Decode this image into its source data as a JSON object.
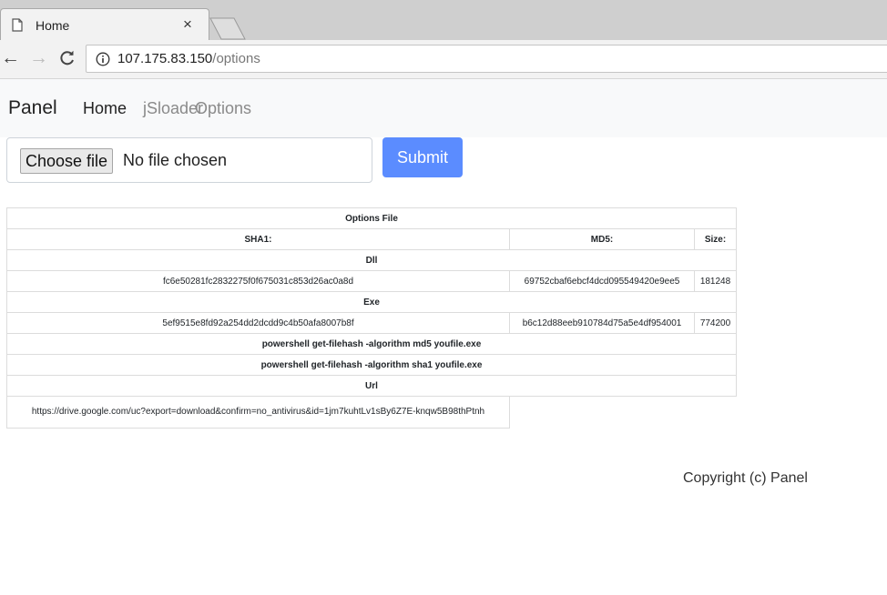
{
  "browser": {
    "tab_title": "Home",
    "tab_close": "×",
    "url_host": "107.175.83.150",
    "url_path": "/options"
  },
  "navbar": {
    "brand": "Panel",
    "links": [
      "Home",
      "jSloader",
      "Options"
    ]
  },
  "upload": {
    "choose_label": "Choose file",
    "status": "No file chosen",
    "submit_label": "Submit"
  },
  "table": {
    "title": "Options File",
    "headers": {
      "sha1": "SHA1:",
      "md5": "MD5:",
      "size": "Size:"
    },
    "dll": {
      "label": "Dll",
      "sha1": "fc6e50281fc2832275f0f675031c853d26ac0a8d",
      "md5": "69752cbaf6ebcf4dcd095549420e9ee5",
      "size": "181248"
    },
    "exe": {
      "label": "Exe",
      "sha1": "5ef9515e8fd92a254dd2dcdd9c4b50afa8007b8f",
      "md5": "b6c12d88eeb910784d75a5e4df954001",
      "size": "774200"
    },
    "cmd_md5": "powershell get-filehash -algorithm md5 youfile.exe",
    "cmd_sha1": "powershell get-filehash -algorithm sha1 youfile.exe",
    "url_label": "Url",
    "url_value": "https://drive.google.com/uc?export=download&confirm=no_antivirus&id=1jm7kuhtLv1sBy6Z7E-knqw5B98thPtnh"
  },
  "footer": {
    "copyright": "Copyright (c) Panel"
  },
  "colors": {
    "submit": "#5b8cff",
    "navbar_bg": "#f8f9fa"
  }
}
